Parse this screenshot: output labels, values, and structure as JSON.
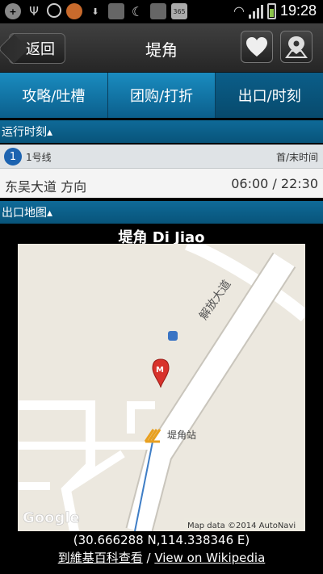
{
  "status_bar": {
    "time": "19:28",
    "icons": [
      "add-icon",
      "usb-icon",
      "gps-icon",
      "app-icon",
      "download-icon",
      "no-signal-icon",
      "moon-icon",
      "no-signal-icon-2",
      "calendar-icon"
    ],
    "calendar_badge": "365"
  },
  "header": {
    "back_label": "返回",
    "title": "堤角"
  },
  "tabs": [
    {
      "label": "攻略/吐槽",
      "active": false
    },
    {
      "label": "团购/打折",
      "active": false
    },
    {
      "label": "出口/时刻",
      "active": true
    }
  ],
  "schedule": {
    "section_title": "运行时刻▴",
    "line_number": "1",
    "line_name": "1号线",
    "times_header": "首/末时间",
    "direction": "东吴大道 方向",
    "times": "06:00 / 22:30"
  },
  "exit_map": {
    "section_title": "出口地图▴",
    "title": "堤角 Di Jiao",
    "road_label": "解放大道",
    "station_label": "堤角站",
    "marker_label": "M",
    "google_label": "Google",
    "map_credit": "Map data ©2014 AutoNavi",
    "coords": "(30.666288 N,114.338346 E)",
    "link_cn": "到維基百科查看",
    "link_sep": " / ",
    "link_en": "View on Wikipedia"
  },
  "colors": {
    "tab_blue": "#0d5d87",
    "line_badge": "#1c63b0",
    "marker_red": "#d8322b"
  }
}
